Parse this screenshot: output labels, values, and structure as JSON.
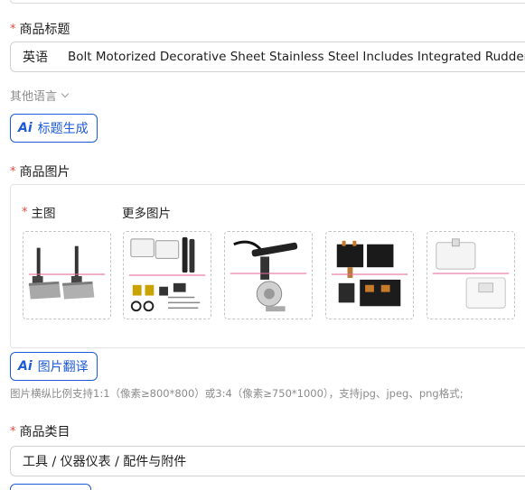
{
  "title_section": {
    "label": "商品标题",
    "language": "英语",
    "value": "Bolt Motorized Decorative Sheet Stainless Steel Includes Integrated Rudder Control",
    "other_languages": "其他语言",
    "ai_button": "标题生成"
  },
  "images_section": {
    "label": "商品图片",
    "main_image_label": "主图",
    "more_images_label": "更多图片",
    "ai_button": "图片翻译",
    "hint": "图片横纵比例支持1:1（像素≥800*800）或3:4（像素≥750*1000），支持jpg、jpeg、png格式;",
    "thumbnails": [
      "trim-tab-plates",
      "actuator-kit-parts",
      "motor-actuator-arm",
      "relay-switch-box",
      "mounting-plates"
    ]
  },
  "category_section": {
    "label": "商品类目",
    "value": "工具 / 仪器仪表 / 配件与附件"
  },
  "ai_icon_text": "Ai",
  "colors": {
    "accent": "#1e5bd8",
    "required": "#e5483f",
    "muted": "#8c8c8c",
    "border": "#d0d0d0"
  }
}
